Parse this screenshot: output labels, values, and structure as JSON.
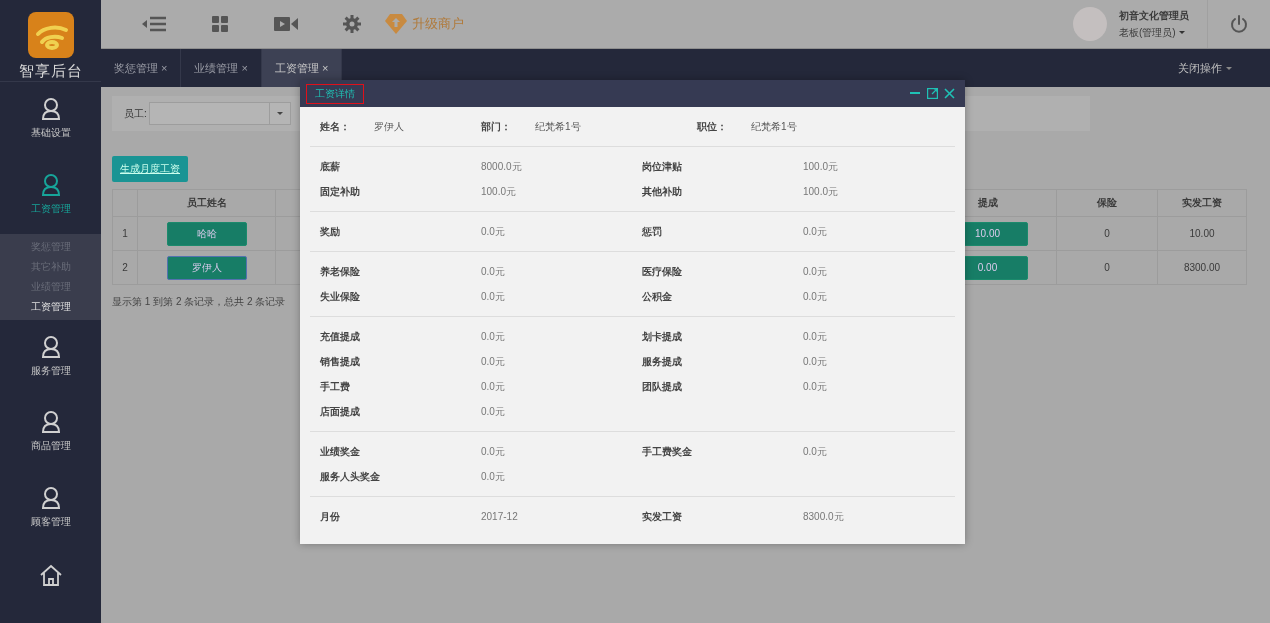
{
  "sidebar": {
    "logo_text": "智享后台",
    "items": [
      {
        "label": "基础设置",
        "selected": false
      },
      {
        "label": "工资管理",
        "selected": true,
        "children": [
          {
            "label": "奖惩管理",
            "selected": false
          },
          {
            "label": "其它补助",
            "selected": false
          },
          {
            "label": "业绩管理",
            "selected": false
          },
          {
            "label": "工资管理",
            "selected": true
          }
        ]
      },
      {
        "label": "服务管理",
        "selected": false
      },
      {
        "label": "商品管理",
        "selected": false
      },
      {
        "label": "顾客管理",
        "selected": false
      }
    ]
  },
  "topbar": {
    "upgrade_label": "升级商户",
    "user_name": "初音文化管理员",
    "user_role": "老板(管理员)"
  },
  "tabs": {
    "items": [
      {
        "label": "奖惩管理",
        "close": "×",
        "selected": false
      },
      {
        "label": "业绩管理",
        "close": "×",
        "selected": false
      },
      {
        "label": "工资管理",
        "close": "×",
        "selected": true
      }
    ],
    "close_menu": "关闭操作"
  },
  "filter": {
    "label": "员工:"
  },
  "generate_button": "生成月度工资",
  "table": {
    "columns": [
      "员工姓名",
      "提成",
      "保险",
      "实发工资"
    ],
    "rows": [
      {
        "number": "1",
        "name": "哈哈",
        "commission": "10.00",
        "insurance": "0",
        "net_pay": "10.00",
        "focused": false
      },
      {
        "number": "2",
        "name": "罗伊人",
        "commission": "0.00",
        "insurance": "0",
        "net_pay": "8300.00",
        "focused": true
      }
    ]
  },
  "pagination_text": "显示第 1 到第 2 条记录，总共 2 条记录",
  "dialog": {
    "title": "工资详情",
    "info": [
      {
        "label": "姓名：",
        "value": "罗伊人"
      },
      {
        "label": "部门：",
        "value": "纪梵希1号"
      },
      {
        "label": "职位：",
        "value": "纪梵希1号"
      }
    ],
    "sections": [
      {
        "fields": [
          {
            "label": "底薪",
            "value": "8000.0元"
          },
          {
            "label": "岗位津贴",
            "value": "100.0元"
          },
          {
            "label": "固定补助",
            "value": "100.0元"
          },
          {
            "label": "其他补助",
            "value": "100.0元"
          }
        ]
      },
      {
        "fields": [
          {
            "label": "奖励",
            "value": "0.0元"
          },
          {
            "label": "惩罚",
            "value": "0.0元"
          }
        ]
      },
      {
        "fields": [
          {
            "label": "养老保险",
            "value": "0.0元"
          },
          {
            "label": "医疗保险",
            "value": "0.0元"
          },
          {
            "label": "失业保险",
            "value": "0.0元"
          },
          {
            "label": "公积金",
            "value": "0.0元"
          }
        ]
      },
      {
        "fields": [
          {
            "label": "充值提成",
            "value": "0.0元"
          },
          {
            "label": "划卡提成",
            "value": "0.0元"
          },
          {
            "label": "销售提成",
            "value": "0.0元"
          },
          {
            "label": "服务提成",
            "value": "0.0元"
          },
          {
            "label": "手工费",
            "value": "0.0元"
          },
          {
            "label": "团队提成",
            "value": "0.0元"
          },
          {
            "label": "店面提成",
            "value": "0.0元"
          }
        ]
      },
      {
        "fields": [
          {
            "label": "业绩奖金",
            "value": "0.0元"
          },
          {
            "label": "手工费奖金",
            "value": "0.0元"
          },
          {
            "label": "服务人头奖金",
            "value": "0.0元"
          }
        ]
      },
      {
        "fields": [
          {
            "label": "月份",
            "value": "2017-12"
          },
          {
            "label": "实发工资",
            "value": "8300.0元"
          }
        ]
      }
    ]
  }
}
